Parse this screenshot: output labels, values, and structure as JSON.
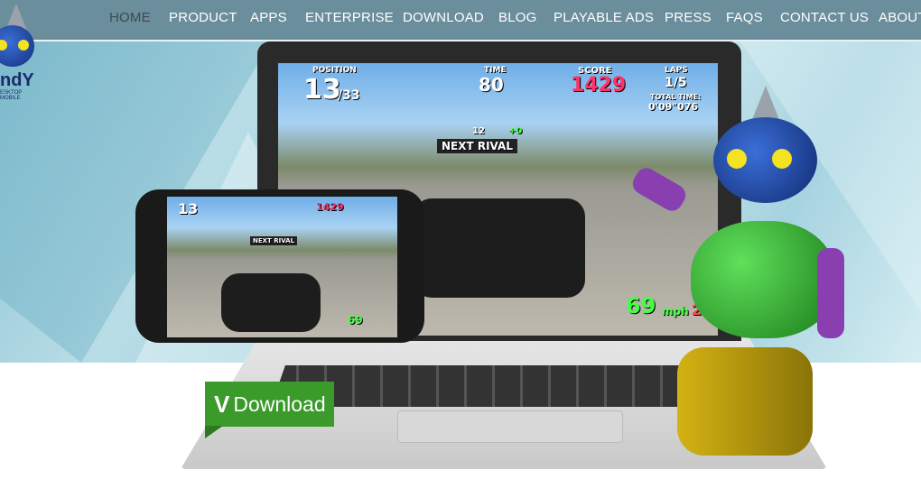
{
  "nav": {
    "items": [
      {
        "label": "HOME",
        "active": true
      },
      {
        "label": "PRODUCT"
      },
      {
        "label": "APPS"
      },
      {
        "label": "ENTERPRISE"
      },
      {
        "label": "DOWNLOAD"
      },
      {
        "label": "BLOG"
      },
      {
        "label": "PLAYABLE ADS"
      },
      {
        "label": "PRESS"
      },
      {
        "label": "FAQS"
      },
      {
        "label": "CONTACT US"
      },
      {
        "label": "ABOUT"
      }
    ]
  },
  "logo": {
    "text": "ndY",
    "subtitle": "ESKTOP MOBILE"
  },
  "game": {
    "position_label": "POSITION",
    "position": "13",
    "position_total": "/33",
    "time_label": "TIME",
    "time": "80",
    "score_label": "SCORE",
    "score": "1429",
    "laps_label": "LAPS",
    "laps": "1/5",
    "total_time_label": "TOTAL TIME:",
    "total_time": "0'09\"076",
    "next_rival": "NEXT RIVAL",
    "rival_position": "12",
    "rival_laps": "+0",
    "speed": "69",
    "speed_unit": "mph",
    "gear": "2"
  },
  "download": {
    "icon": "v-logo",
    "label": "Download",
    "icon_letter": "V"
  },
  "colors": {
    "nav": "#6b8e9c",
    "download": "#3a9a2a"
  }
}
